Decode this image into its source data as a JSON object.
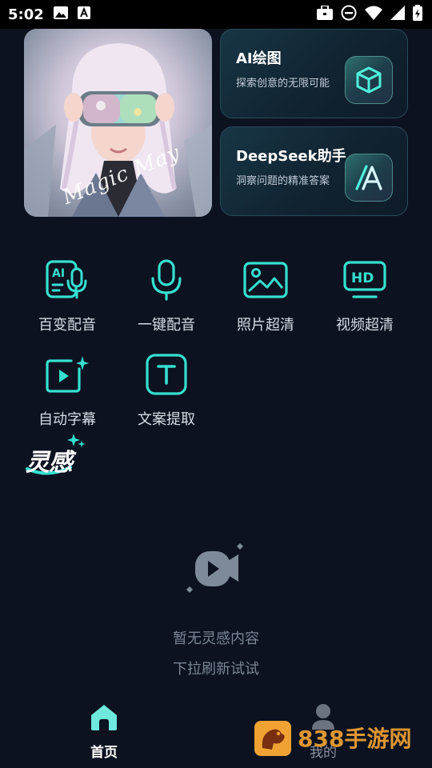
{
  "status_bar": {
    "time": "5:02"
  },
  "hero": {
    "watermark_text": "Magic May"
  },
  "feature_cards": [
    {
      "title": "AI绘图",
      "subtitle": "探索创意的无限可能",
      "icon": "cube-icon"
    },
    {
      "title": "DeepSeek助手",
      "subtitle": "洞察问题的精准答案",
      "icon": "deepseek-a-icon"
    }
  ],
  "tools": [
    {
      "label": "百变配音",
      "icon": "ai-microphone-icon"
    },
    {
      "label": "一键配音",
      "icon": "microphone-icon"
    },
    {
      "label": "照片超清",
      "icon": "image-icon"
    },
    {
      "label": "视频超清",
      "icon": "hd-icon"
    },
    {
      "label": "自动字幕",
      "icon": "video-sparkle-icon"
    },
    {
      "label": "文案提取",
      "icon": "text-t-icon"
    }
  ],
  "inspiration": {
    "title": "灵感",
    "empty_line1": "暂无灵感内容",
    "empty_line2": "下拉刷新试试"
  },
  "bottom_nav": [
    {
      "label": "首页",
      "icon": "home-icon",
      "active": true
    },
    {
      "label": "我的",
      "icon": "user-icon",
      "active": false
    }
  ],
  "site_watermark": {
    "text": "838手游网"
  },
  "colors": {
    "background": "#0c1220",
    "accent": "#35e0d0",
    "muted_text": "#7b8594"
  }
}
